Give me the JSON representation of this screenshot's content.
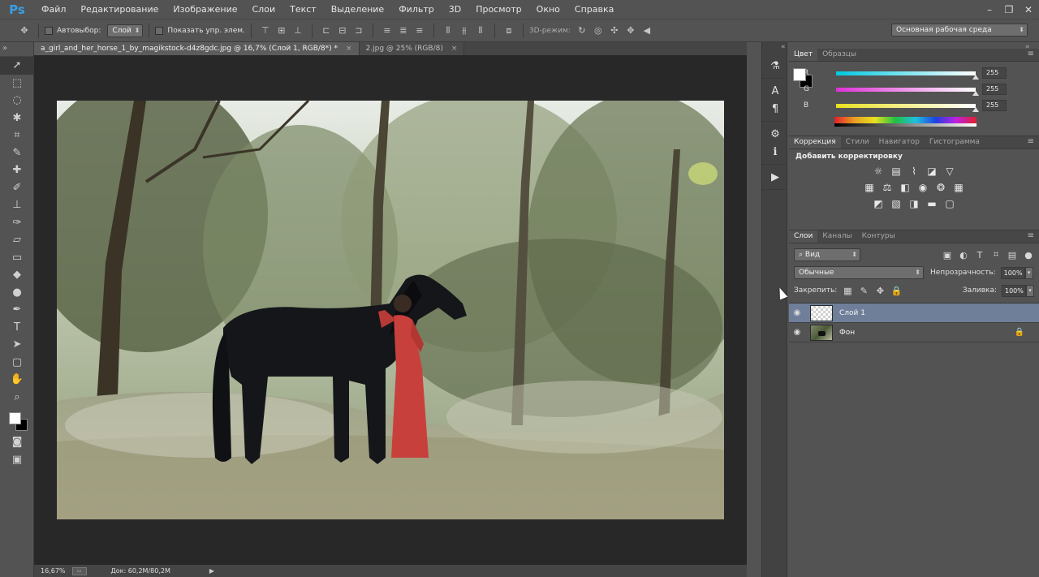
{
  "app": {
    "logo": "Ps"
  },
  "menu": [
    "Файл",
    "Редактирование",
    "Изображение",
    "Слои",
    "Текст",
    "Выделение",
    "Фильтр",
    "3D",
    "Просмотр",
    "Окно",
    "Справка"
  ],
  "window_controls": [
    "–",
    "❐",
    "✕"
  ],
  "options": {
    "autoselect_label": "Автовыбор:",
    "autoselect_value": "Слой",
    "show_transform_label": "Показать упр. элем.",
    "mode3d_label": "3D-режим:",
    "workspace": "Основная рабочая среда"
  },
  "doc_tabs": [
    {
      "label": "a_girl_and_her_horse_1_by_magikstock-d4z8gdc.jpg @ 16,7% (Слой 1, RGB/8*) *",
      "close": "×",
      "active": true
    },
    {
      "label": "2.jpg @ 25% (RGB/8)",
      "close": "×",
      "active": false
    }
  ],
  "status": {
    "zoom": "16,67%",
    "doc": "Док: 60,2M/80,2M",
    "arrow": "▶"
  },
  "color_panel": {
    "tabs": [
      "Цвет",
      "Образцы"
    ],
    "channels": [
      {
        "label": "R",
        "value": "255",
        "color": "#00c8e0"
      },
      {
        "label": "G",
        "value": "255",
        "color": "#e030d8"
      },
      {
        "label": "B",
        "value": "255",
        "color": "#e8e020"
      }
    ]
  },
  "adjustments": {
    "tabs": [
      "Коррекция",
      "Стили",
      "Навигатор",
      "Гистограмма"
    ],
    "title": "Добавить корректировку"
  },
  "layers_panel": {
    "tabs": [
      "Слои",
      "Каналы",
      "Контуры"
    ],
    "filter": "⌕ Вид",
    "blend_mode": "Обычные",
    "opacity_label": "Непрозрачность:",
    "opacity": "100%",
    "lock_label": "Закрепить:",
    "fill_label": "Заливка:",
    "fill": "100%",
    "layers": [
      {
        "name": "Слой 1",
        "selected": true
      },
      {
        "name": "Фон",
        "selected": false
      }
    ]
  }
}
